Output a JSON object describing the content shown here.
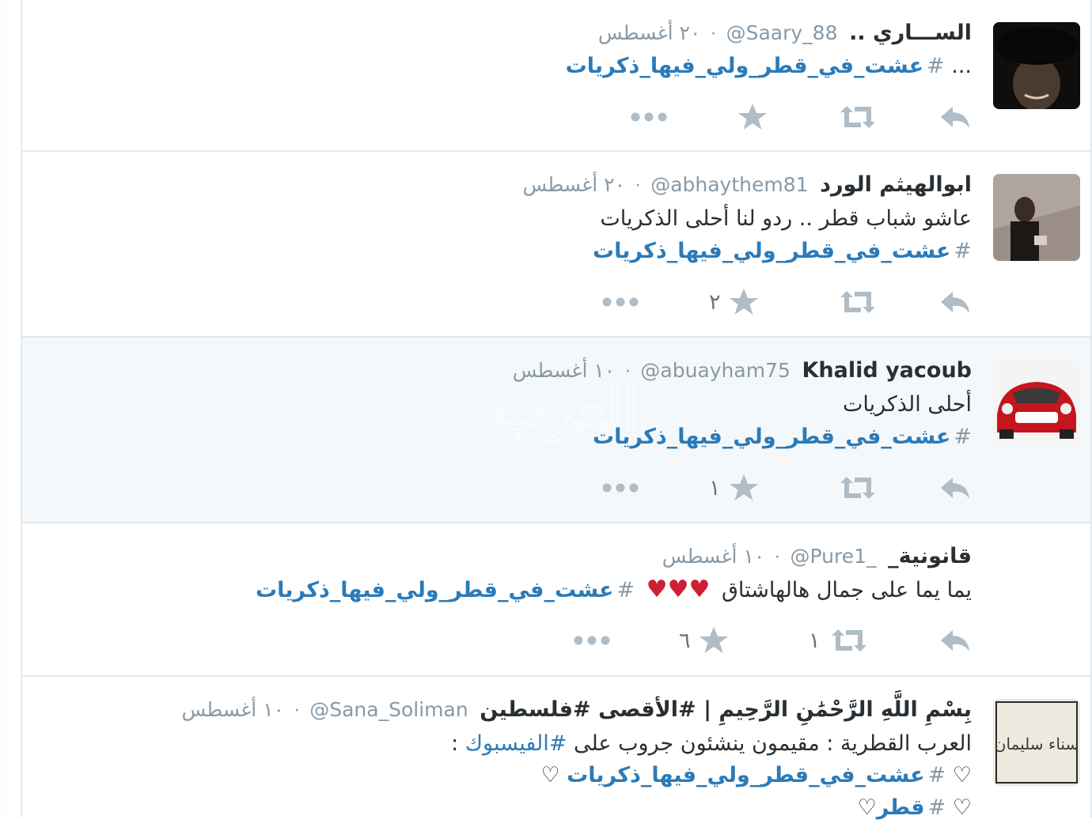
{
  "tweets": [
    {
      "fullname": "الســـاري ..",
      "screenname": "@Saary_88",
      "time": "٢٠ أغسطس",
      "lines": [
        {
          "prefix": "...",
          "hashtag": "عشت_في_قطر_ولي_فيها_ذكريات"
        }
      ],
      "favorite_count": "",
      "retweet_count": ""
    },
    {
      "fullname": "ابوالهيثم الورد",
      "screenname": "@abhaythem81",
      "time": "٢٠ أغسطس",
      "lines": [
        {
          "text": "عاشو شباب قطر .. ردو لنا أحلى الذكريات"
        },
        {
          "hashtag": "عشت_في_قطر_ولي_فيها_ذكريات"
        }
      ],
      "favorite_count": "٢",
      "retweet_count": ""
    },
    {
      "fullname": "Khalid yacoub",
      "screenname": "@abuayham75",
      "time": "١٠ أغسطس",
      "lines": [
        {
          "text": "أحلى الذكريات"
        },
        {
          "hashtag": "عشت_في_قطر_ولي_فيها_ذكريات"
        }
      ],
      "favorite_count": "١",
      "retweet_count": ""
    },
    {
      "fullname": "قانونية_",
      "screenname": "@Pure1_",
      "time": "١٠ أغسطس",
      "lines": [
        {
          "text": "يما يما على جمال هالهاشتاق",
          "hearts": "♥♥♥",
          "hashtag": "عشت_في_قطر_ولي_فيها_ذكريات"
        }
      ],
      "favorite_count": "٦",
      "retweet_count": "١"
    },
    {
      "fullname": "بِسْمِ اللَّهِ الرَّحْمَٰنِ الرَّحِيمِ | #الأقصى #فلسطين",
      "screenname": "@Sana_Soliman",
      "time": "١٠ أغسطس",
      "lines": [
        {
          "text": "العرب القطرية : مقيمون ينشئون جروب على",
          "link": "#الفيسبوك",
          "suffix": ":"
        },
        {
          "heart": "♡",
          "hashtag": "عشت_في_قطر_ولي_فيها_ذكريات",
          "heart_after": "♡"
        },
        {
          "heart": "♡",
          "hashtag": "قطر",
          "heart_after": "♡"
        }
      ],
      "favorite_count": "",
      "retweet_count": ""
    }
  ],
  "hash_symbol": "#",
  "watermark": "العرب",
  "avatar_text_5": "سناء سليمان",
  "colors": {
    "link": "#2b7bb9",
    "meta": "#8899a6",
    "icon": "#b0bcc6",
    "heart_red": "#cc1f34"
  }
}
